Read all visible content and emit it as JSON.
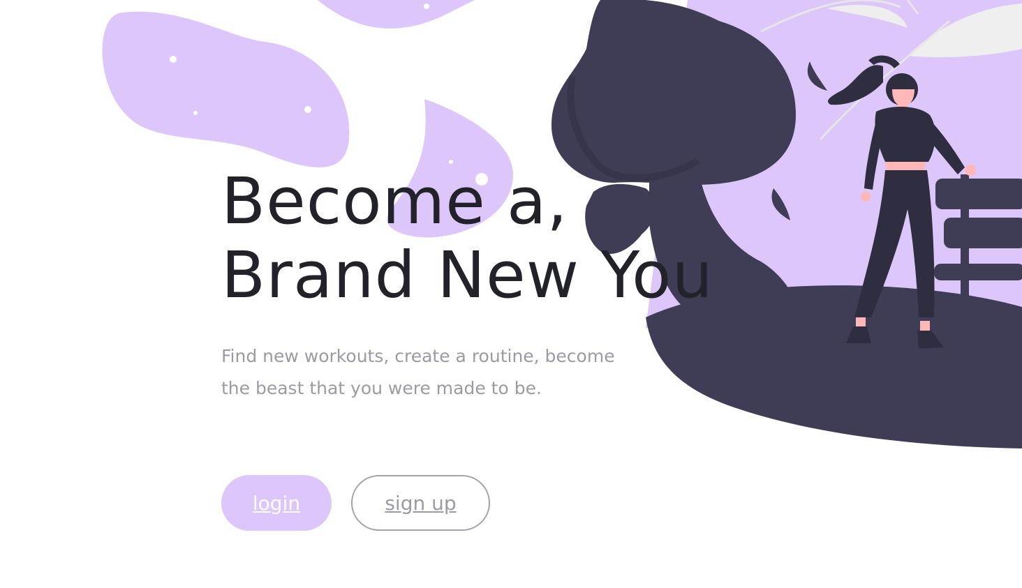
{
  "hero": {
    "headline_line1": "Become a,",
    "headline_line2": "Brand New You",
    "subtitle": "Find new workouts, create a routine, become the beast that you were made to be."
  },
  "actions": {
    "login_label": "login",
    "signup_label": "sign up"
  },
  "colors": {
    "accent_lavender": "#dcc6fa",
    "dark_slate": "#3f3d56",
    "headline_text": "#22222a",
    "muted_text": "#9b9aa6",
    "skin": "#ffb8b8"
  }
}
